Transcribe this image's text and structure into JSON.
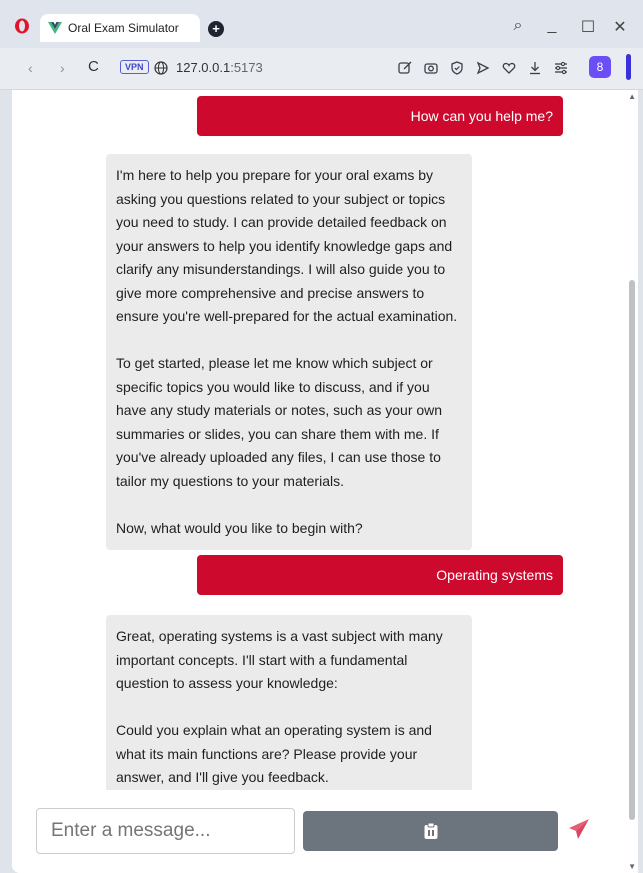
{
  "browser": {
    "tab_title": "Oral Exam Simulator",
    "new_tab": "+",
    "vpn_label": "VPN",
    "url_host": "127.0.0.1",
    "url_port": ":5173",
    "profile_glyph": "8",
    "back_glyph": "‹",
    "forward_glyph": "›",
    "reload_glyph": "C",
    "search_glyph": "⌕",
    "minimize_glyph": "_",
    "maximize_glyph": "☐",
    "close_glyph": "✕"
  },
  "chat": {
    "messages": [
      {
        "role": "user",
        "text": "How can you help me?"
      },
      {
        "role": "assistant",
        "paragraphs": [
          "I'm here to help you prepare for your oral exams by asking you questions related to your subject or topics you need to study. I can provide detailed feedback on your answers to help you identify knowledge gaps and clarify any misunderstandings. I will also guide you to give more comprehensive and precise answers to ensure you're well-prepared for the actual examination.",
          "To get started, please let me know which subject or specific topics you would like to discuss, and if you have any study materials or notes, such as your own summaries or slides, you can share them with me. If you've already uploaded any files, I can use those to tailor my questions to your materials.",
          "Now, what would you like to begin with?"
        ]
      },
      {
        "role": "user",
        "text": "Operating systems"
      },
      {
        "role": "assistant",
        "paragraphs": [
          "Great, operating systems is a vast subject with many important concepts. I'll start with a fundamental question to assess your knowledge:",
          "Could you explain what an operating system is and what its main functions are? Please provide your answer, and I'll give you feedback."
        ]
      }
    ]
  },
  "composer": {
    "placeholder": "Enter a message...",
    "upload_icon": "clipboard-icon",
    "send_icon": "paper-plane-icon"
  },
  "colors": {
    "user_bubble": "#cd0a2d",
    "bot_bubble": "#ebebeb",
    "upload_button": "#6c757d",
    "send_icon": "#e36176"
  }
}
